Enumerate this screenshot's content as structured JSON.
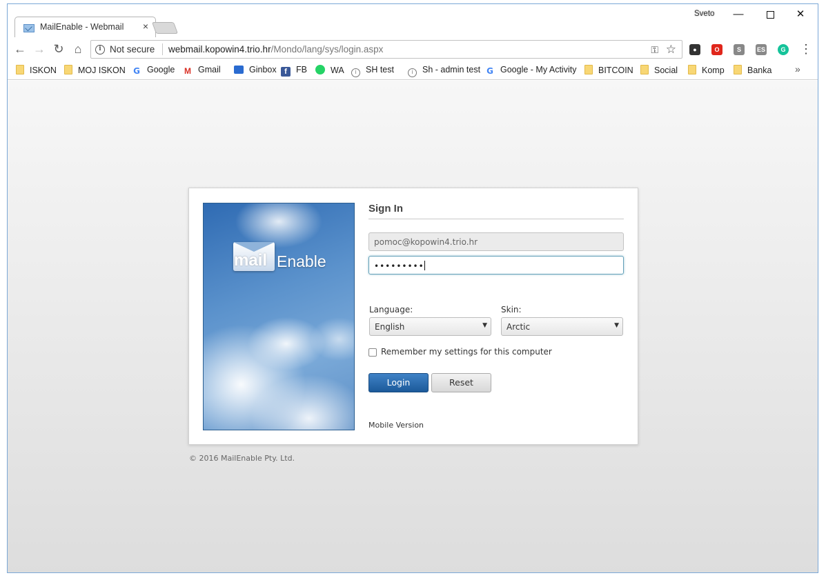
{
  "browser": {
    "tab_title": "MailEnable - Webmail",
    "tab_close": "×",
    "profile_name": "Sveto",
    "window_controls": {
      "minimize": "—",
      "close": "✕"
    },
    "nav": {
      "back": "←",
      "forward": "→",
      "reload": "↻",
      "home": "⌂"
    },
    "omnibox": {
      "security_label": "Not secure",
      "url_host": "webmail.kopowin4.trio.hr",
      "url_path": "/Mondo/lang/sys/login.aspx"
    },
    "extensions": [
      {
        "name": "ghostery",
        "glyph": "●",
        "color": "#333333"
      },
      {
        "name": "opera",
        "glyph": "O",
        "color": "#e0261b"
      },
      {
        "name": "s-ext",
        "glyph": "S",
        "color": "#888888"
      },
      {
        "name": "es-ext",
        "glyph": "ES",
        "color": "#888888"
      },
      {
        "name": "grammarly",
        "glyph": "G",
        "color": "#15c39a"
      }
    ],
    "menu": "⋮",
    "bookmarks": [
      {
        "label": "ISKON",
        "icon": "folder"
      },
      {
        "label": "MOJ ISKON",
        "icon": "folder"
      },
      {
        "label": "Google",
        "icon": "google"
      },
      {
        "label": "Gmail",
        "icon": "gmail"
      },
      {
        "label": "Ginbox",
        "icon": "inbox"
      },
      {
        "label": "FB",
        "icon": "facebook"
      },
      {
        "label": "WA",
        "icon": "whatsapp"
      },
      {
        "label": "SH test",
        "icon": "info"
      },
      {
        "label": "Sh - admin test",
        "icon": "info"
      },
      {
        "label": "Google - My Activity",
        "icon": "google"
      },
      {
        "label": "BITCOIN",
        "icon": "folder"
      },
      {
        "label": "Social",
        "icon": "folder"
      },
      {
        "label": "Komp",
        "icon": "folder"
      },
      {
        "label": "Banka",
        "icon": "folder"
      }
    ],
    "bookmarks_more": "»"
  },
  "login": {
    "logo": {
      "mail": "mail",
      "enable": "Enable"
    },
    "title": "Sign In",
    "email_value": "pomoc@kopowin4.trio.hr",
    "password_mask": "•••••••••",
    "language_label": "Language:",
    "language_value": "English",
    "skin_label": "Skin:",
    "skin_value": "Arctic",
    "remember_label": "Remember my settings for this computer",
    "remember_checked": false,
    "login_button": "Login",
    "reset_button": "Reset",
    "mobile_link": "Mobile Version",
    "copyright": "© 2016 MailEnable Pty. Ltd."
  },
  "colors": {
    "login_button": "#1c5a9a",
    "focus_border": "#62a0b8",
    "window_border": "#7aa7d6"
  }
}
